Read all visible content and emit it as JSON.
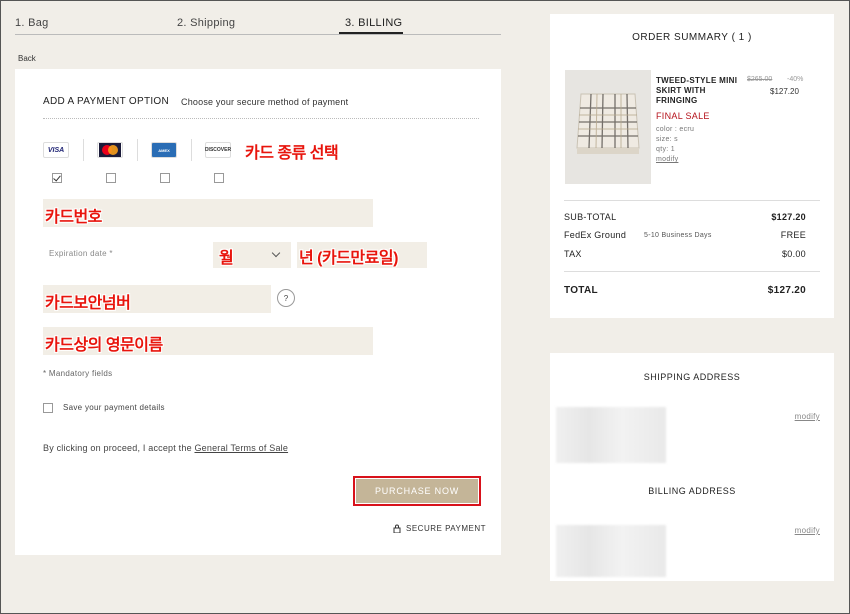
{
  "steps": [
    {
      "label": "1. Bag"
    },
    {
      "label": "2. Shipping"
    },
    {
      "label": "3. BILLING"
    }
  ],
  "back_label": "Back",
  "payment": {
    "title": "ADD A PAYMENT OPTION",
    "subtitle": "Choose your secure method of payment",
    "cards": [
      {
        "name": "VISA",
        "checked": true
      },
      {
        "name": "MasterCard",
        "checked": false
      },
      {
        "name": "AMERICAN EXPRESS",
        "checked": false
      },
      {
        "name": "DISCOVER",
        "checked": false
      }
    ],
    "annotation_card_type": "카드 종류 선택",
    "annotation_card_number": "카드번호",
    "expiration_label": "Expiration date *",
    "annotation_month": "월",
    "annotation_year": "년 (카드만료일)",
    "annotation_cvv": "카드보안넘버",
    "help_label": "?",
    "annotation_name": "카드상의 영문이름",
    "mandatory": "* Mandatory fields",
    "save_details": "Save your payment details",
    "terms_prefix": "By clicking on proceed, I accept the",
    "terms_link": "General Terms of Sale",
    "purchase_button": "PURCHASE NOW",
    "secure_payment": "SECURE PAYMENT"
  },
  "summary": {
    "title": "ORDER SUMMARY ( 1 )",
    "product": {
      "name": "TWEED-STYLE MINI SKIRT WITH FRINGING",
      "old_price": "$265.00",
      "discount": "-40%",
      "price": "$127.20",
      "final_sale": "FINAL SALE",
      "color": "color : ecru",
      "size": "size: s",
      "qty": "qty: 1",
      "modify": "modify"
    },
    "subtotal_label": "SUB-TOTAL",
    "subtotal_value": "$127.20",
    "shipping_label": "FedEx Ground",
    "shipping_days": "5-10 Business Days",
    "shipping_value": "FREE",
    "tax_label": "TAX",
    "tax_value": "$0.00",
    "total_label": "TOTAL",
    "total_value": "$127.20"
  },
  "addresses": {
    "shipping_title": "SHIPPING ADDRESS",
    "billing_title": "BILLING ADDRESS",
    "modify": "modify"
  },
  "colors": {
    "accent_red": "#e8140c",
    "button": "#c4b598",
    "final_sale": "#b5121b"
  }
}
